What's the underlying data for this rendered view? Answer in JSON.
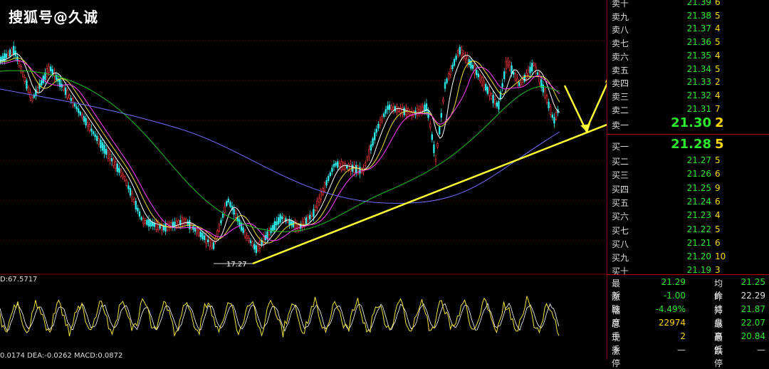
{
  "watermark": "搜狐号@久诚",
  "chart": {
    "low_label": "17.27",
    "osc_label": "D:67.5717",
    "macd_label": "0.0174  DEA:-0.0262  MACD:0.0872"
  },
  "colors": {
    "candle_up": "#ff3b3b",
    "candle_down": "#2ee8e8",
    "ma_white": "#ffffff",
    "ma_yellow": "#f0e040",
    "ma_magenta": "#ff40ff",
    "ma_green": "#20c020",
    "ma_blue": "#7070ff",
    "trendline": "#ffff33",
    "grid": "#8b0000",
    "bid_price": "#2ee82e",
    "volume": "#ffd700"
  },
  "order_book": {
    "asks": [
      {
        "label": "卖十",
        "price": "21.39",
        "vol": "6"
      },
      {
        "label": "卖九",
        "price": "21.38",
        "vol": "5"
      },
      {
        "label": "卖八",
        "price": "21.37",
        "vol": "4"
      },
      {
        "label": "卖七",
        "price": "21.36",
        "vol": "5"
      },
      {
        "label": "卖六",
        "price": "21.35",
        "vol": "4"
      },
      {
        "label": "卖五",
        "price": "21.34",
        "vol": "5"
      },
      {
        "label": "卖四",
        "price": "21.33",
        "vol": "2"
      },
      {
        "label": "卖三",
        "price": "21.32",
        "vol": "4"
      },
      {
        "label": "卖二",
        "price": "21.31",
        "vol": "7"
      },
      {
        "label": "卖一",
        "price": "21.30",
        "vol": "2"
      }
    ],
    "bids": [
      {
        "label": "买一",
        "price": "21.28",
        "vol": "5"
      },
      {
        "label": "买二",
        "price": "21.27",
        "vol": "5"
      },
      {
        "label": "买三",
        "price": "21.26",
        "vol": "6"
      },
      {
        "label": "买四",
        "price": "21.25",
        "vol": "9"
      },
      {
        "label": "买五",
        "price": "21.24",
        "vol": "6"
      },
      {
        "label": "买六",
        "price": "21.23",
        "vol": "4"
      },
      {
        "label": "买七",
        "price": "21.22",
        "vol": "5"
      },
      {
        "label": "买八",
        "price": "21.21",
        "vol": "6"
      },
      {
        "label": "买九",
        "price": "21.20",
        "vol": "10"
      },
      {
        "label": "买十",
        "price": "21.19",
        "vol": "3"
      }
    ]
  },
  "stats": {
    "latest_label": "最新",
    "latest": "21.29",
    "avg_label": "均价",
    "avg": "21.25",
    "change_label": "涨跌",
    "change": "-1.00",
    "prev_close_label": "昨结",
    "prev_close": "22.29",
    "pct_label": "幅度",
    "pct": "-4.49%",
    "open_label": "开盘",
    "open": "21.87",
    "total_label": "总手",
    "total": "22974",
    "high_label": "最高",
    "high": "22.07",
    "current_label": "现手",
    "current": "2",
    "low_label": "最低",
    "low": "20.84",
    "limit_up_label": "涨停",
    "limit_up": "—",
    "limit_down_label": "跌停",
    "limit_down": "—"
  }
}
